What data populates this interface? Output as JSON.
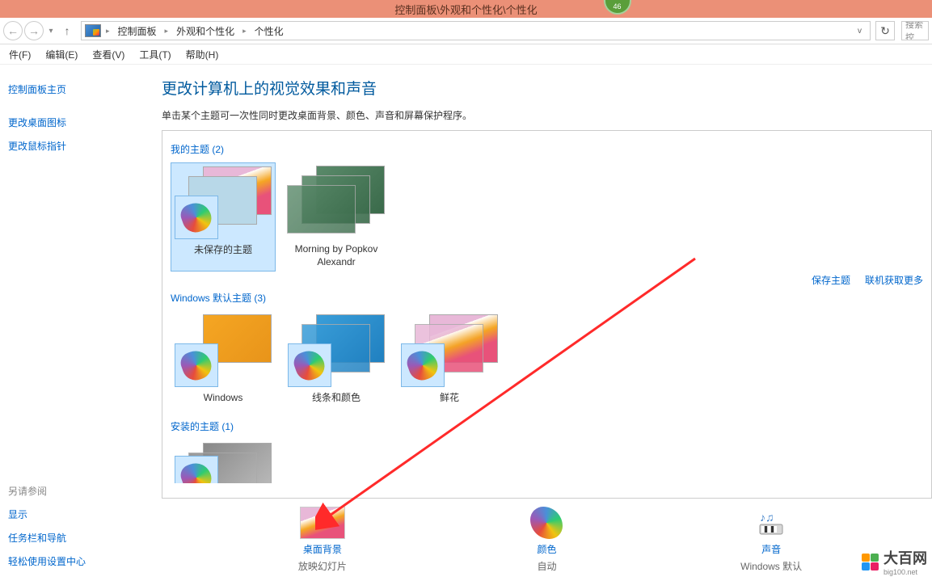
{
  "title_bar": {
    "path": "控制面板\\外观和个性化\\个性化",
    "badge": "46"
  },
  "breadcrumb": {
    "items": [
      "控制面板",
      "外观和个性化",
      "个性化"
    ]
  },
  "search": {
    "placeholder": "搜索控"
  },
  "menu": {
    "file": "件(F)",
    "edit": "编辑(E)",
    "view": "查看(V)",
    "tools": "工具(T)",
    "help": "帮助(H)"
  },
  "sidebar": {
    "home": "控制面板主页",
    "icons": "更改桌面图标",
    "pointers": "更改鼠标指针",
    "see_also": "另请参阅",
    "display": "显示",
    "taskbar": "任务栏和导航",
    "ease": "轻松使用设置中心"
  },
  "page": {
    "title": "更改计算机上的视觉效果和声音",
    "desc": "单击某个主题可一次性同时更改桌面背景、颜色、声音和屏幕保护程序。"
  },
  "sections": {
    "my_themes": {
      "header": "我的主题 (2)",
      "save": "保存主题",
      "online": "联机获取更多"
    },
    "default_themes": {
      "header": "Windows 默认主题 (3)"
    },
    "installed_themes": {
      "header": "安装的主题 (1)"
    }
  },
  "themes": {
    "unsaved": "未保存的主题",
    "morning": "Morning by Popkov Alexandr",
    "windows": "Windows",
    "lines": "线条和颜色",
    "flowers": "鲜花"
  },
  "bottom": {
    "bg": {
      "title": "桌面背景",
      "sub": "放映幻灯片"
    },
    "color": {
      "title": "颜色",
      "sub": "自动"
    },
    "sound": {
      "title": "声音",
      "sub": "Windows 默认"
    }
  },
  "watermark": {
    "text": "大百网",
    "sub": "big100.net"
  }
}
